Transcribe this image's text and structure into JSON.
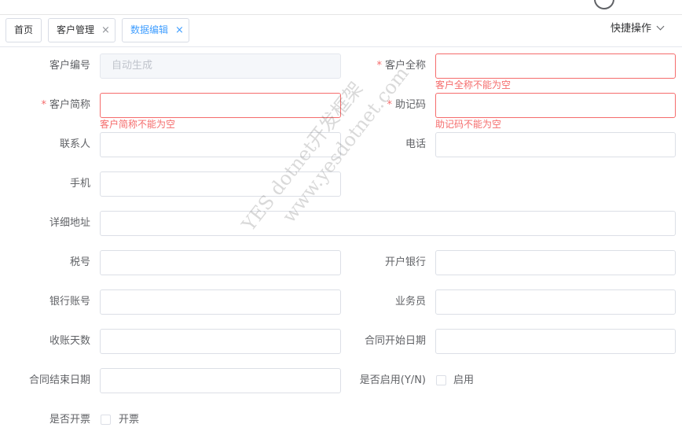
{
  "tabs": [
    {
      "label": "首页",
      "closable": false,
      "active": false
    },
    {
      "label": "客户管理",
      "closable": true,
      "active": false
    },
    {
      "label": "数据编辑",
      "closable": true,
      "active": true
    }
  ],
  "close_glyph": "×",
  "quick_actions": {
    "label": "快捷操作",
    "icon": "chevron-down-icon"
  },
  "form": {
    "customer_code": {
      "label": "客户编号",
      "placeholder": "自动生成",
      "disabled": true
    },
    "full_name": {
      "label": "客户全称",
      "required": true,
      "error": "客户全称不能为空"
    },
    "short_name": {
      "label": "客户简称",
      "required": true,
      "error": "客户简称不能为空"
    },
    "mnemonic": {
      "label": "助记码",
      "required": true,
      "error": "助记码不能为空"
    },
    "contact": {
      "label": "联系人"
    },
    "phone": {
      "label": "电话"
    },
    "mobile": {
      "label": "手机"
    },
    "address": {
      "label": "详细地址"
    },
    "tax_no": {
      "label": "税号"
    },
    "bank": {
      "label": "开户银行"
    },
    "bank_account": {
      "label": "银行账号"
    },
    "salesman": {
      "label": "业务员"
    },
    "collect_days": {
      "label": "收账天数"
    },
    "contract_start": {
      "label": "合同开始日期"
    },
    "contract_end": {
      "label": "合同结束日期"
    },
    "enabled": {
      "label": "是否启用(Y/N)",
      "option": "启用",
      "checked": false
    },
    "invoice": {
      "label": "是否开票",
      "option": "开票",
      "checked": false
    }
  },
  "required_mark": "*",
  "watermark": {
    "line1": "YES dotnet开发框架",
    "line2": "www.yesdotnet.com"
  }
}
